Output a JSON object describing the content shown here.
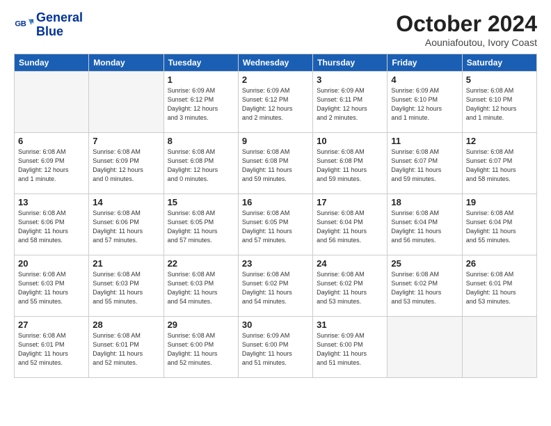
{
  "logo": {
    "line1": "General",
    "line2": "Blue"
  },
  "title": "October 2024",
  "location": "Aouniafoutou, Ivory Coast",
  "days_of_week": [
    "Sunday",
    "Monday",
    "Tuesday",
    "Wednesday",
    "Thursday",
    "Friday",
    "Saturday"
  ],
  "weeks": [
    [
      {
        "day": "",
        "info": ""
      },
      {
        "day": "",
        "info": ""
      },
      {
        "day": "1",
        "info": "Sunrise: 6:09 AM\nSunset: 6:12 PM\nDaylight: 12 hours\nand 3 minutes."
      },
      {
        "day": "2",
        "info": "Sunrise: 6:09 AM\nSunset: 6:12 PM\nDaylight: 12 hours\nand 2 minutes."
      },
      {
        "day": "3",
        "info": "Sunrise: 6:09 AM\nSunset: 6:11 PM\nDaylight: 12 hours\nand 2 minutes."
      },
      {
        "day": "4",
        "info": "Sunrise: 6:09 AM\nSunset: 6:10 PM\nDaylight: 12 hours\nand 1 minute."
      },
      {
        "day": "5",
        "info": "Sunrise: 6:08 AM\nSunset: 6:10 PM\nDaylight: 12 hours\nand 1 minute."
      }
    ],
    [
      {
        "day": "6",
        "info": "Sunrise: 6:08 AM\nSunset: 6:09 PM\nDaylight: 12 hours\nand 1 minute."
      },
      {
        "day": "7",
        "info": "Sunrise: 6:08 AM\nSunset: 6:09 PM\nDaylight: 12 hours\nand 0 minutes."
      },
      {
        "day": "8",
        "info": "Sunrise: 6:08 AM\nSunset: 6:08 PM\nDaylight: 12 hours\nand 0 minutes."
      },
      {
        "day": "9",
        "info": "Sunrise: 6:08 AM\nSunset: 6:08 PM\nDaylight: 11 hours\nand 59 minutes."
      },
      {
        "day": "10",
        "info": "Sunrise: 6:08 AM\nSunset: 6:08 PM\nDaylight: 11 hours\nand 59 minutes."
      },
      {
        "day": "11",
        "info": "Sunrise: 6:08 AM\nSunset: 6:07 PM\nDaylight: 11 hours\nand 59 minutes."
      },
      {
        "day": "12",
        "info": "Sunrise: 6:08 AM\nSunset: 6:07 PM\nDaylight: 11 hours\nand 58 minutes."
      }
    ],
    [
      {
        "day": "13",
        "info": "Sunrise: 6:08 AM\nSunset: 6:06 PM\nDaylight: 11 hours\nand 58 minutes."
      },
      {
        "day": "14",
        "info": "Sunrise: 6:08 AM\nSunset: 6:06 PM\nDaylight: 11 hours\nand 57 minutes."
      },
      {
        "day": "15",
        "info": "Sunrise: 6:08 AM\nSunset: 6:05 PM\nDaylight: 11 hours\nand 57 minutes."
      },
      {
        "day": "16",
        "info": "Sunrise: 6:08 AM\nSunset: 6:05 PM\nDaylight: 11 hours\nand 57 minutes."
      },
      {
        "day": "17",
        "info": "Sunrise: 6:08 AM\nSunset: 6:04 PM\nDaylight: 11 hours\nand 56 minutes."
      },
      {
        "day": "18",
        "info": "Sunrise: 6:08 AM\nSunset: 6:04 PM\nDaylight: 11 hours\nand 56 minutes."
      },
      {
        "day": "19",
        "info": "Sunrise: 6:08 AM\nSunset: 6:04 PM\nDaylight: 11 hours\nand 55 minutes."
      }
    ],
    [
      {
        "day": "20",
        "info": "Sunrise: 6:08 AM\nSunset: 6:03 PM\nDaylight: 11 hours\nand 55 minutes."
      },
      {
        "day": "21",
        "info": "Sunrise: 6:08 AM\nSunset: 6:03 PM\nDaylight: 11 hours\nand 55 minutes."
      },
      {
        "day": "22",
        "info": "Sunrise: 6:08 AM\nSunset: 6:03 PM\nDaylight: 11 hours\nand 54 minutes."
      },
      {
        "day": "23",
        "info": "Sunrise: 6:08 AM\nSunset: 6:02 PM\nDaylight: 11 hours\nand 54 minutes."
      },
      {
        "day": "24",
        "info": "Sunrise: 6:08 AM\nSunset: 6:02 PM\nDaylight: 11 hours\nand 53 minutes."
      },
      {
        "day": "25",
        "info": "Sunrise: 6:08 AM\nSunset: 6:02 PM\nDaylight: 11 hours\nand 53 minutes."
      },
      {
        "day": "26",
        "info": "Sunrise: 6:08 AM\nSunset: 6:01 PM\nDaylight: 11 hours\nand 53 minutes."
      }
    ],
    [
      {
        "day": "27",
        "info": "Sunrise: 6:08 AM\nSunset: 6:01 PM\nDaylight: 11 hours\nand 52 minutes."
      },
      {
        "day": "28",
        "info": "Sunrise: 6:08 AM\nSunset: 6:01 PM\nDaylight: 11 hours\nand 52 minutes."
      },
      {
        "day": "29",
        "info": "Sunrise: 6:08 AM\nSunset: 6:00 PM\nDaylight: 11 hours\nand 52 minutes."
      },
      {
        "day": "30",
        "info": "Sunrise: 6:09 AM\nSunset: 6:00 PM\nDaylight: 11 hours\nand 51 minutes."
      },
      {
        "day": "31",
        "info": "Sunrise: 6:09 AM\nSunset: 6:00 PM\nDaylight: 11 hours\nand 51 minutes."
      },
      {
        "day": "",
        "info": ""
      },
      {
        "day": "",
        "info": ""
      }
    ]
  ]
}
